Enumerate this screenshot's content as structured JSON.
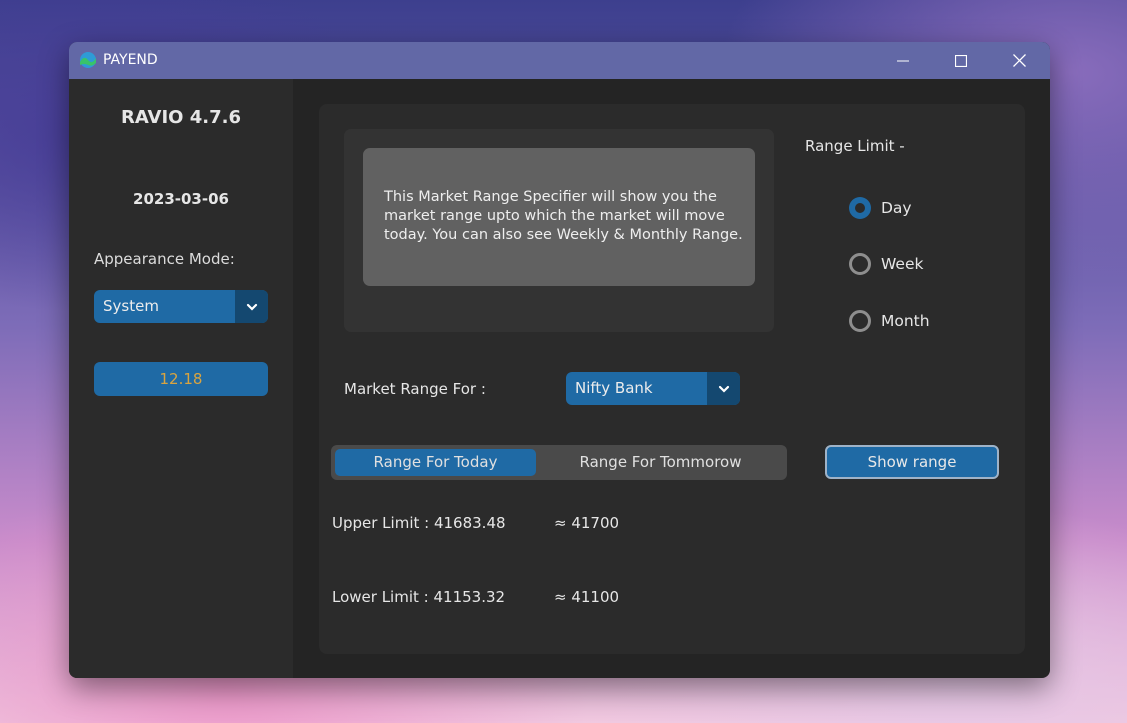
{
  "window": {
    "title": "PAYEND"
  },
  "colors": {
    "accent": "#1f6aa5",
    "accent_dark": "#144870",
    "value_text": "#d9a440",
    "titlebar": "#6268a6"
  },
  "sidebar": {
    "version": "RAVIO 4.7.6",
    "date": "2023-03-06",
    "appearance_label": "Appearance Mode:",
    "appearance_value": "System",
    "value_button": "12.18"
  },
  "main": {
    "description_lines": [
      "This Market Range Specifier will show you the",
      "market range upto which the market will move",
      "today. You can also see Weekly & Monthly Range."
    ],
    "range_limit_label": "Range Limit -",
    "range_options": [
      {
        "label": "Day",
        "selected": true
      },
      {
        "label": "Week",
        "selected": false
      },
      {
        "label": "Month",
        "selected": false
      }
    ],
    "market_range_label": "Market Range For :",
    "market_index": "Nifty Bank",
    "segments": [
      "Range For Today",
      "Range For Tommorow"
    ],
    "selected_segment": "Range For Today",
    "show_button": "Show range",
    "upper_limit": "Upper Limit : 41683.48",
    "upper_approx": "≈ 41700",
    "lower_limit": "Lower Limit : 41153.32",
    "lower_approx": "≈ 41100"
  }
}
